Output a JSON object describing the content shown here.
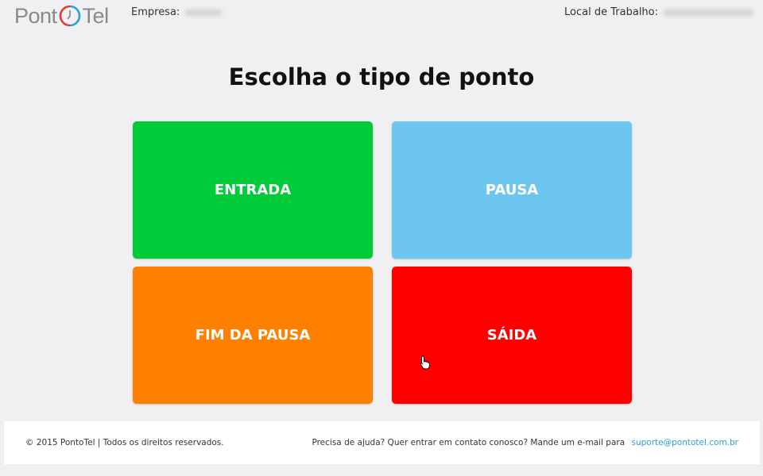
{
  "header": {
    "logo_left": "Pont",
    "logo_right": "Tel",
    "company_label": "Empresa:",
    "workplace_label": "Local de Trabalho:"
  },
  "main": {
    "title": "Escolha o tipo de ponto",
    "buttons": [
      {
        "label": "ENTRADA",
        "color": "#00cc3a"
      },
      {
        "label": "PAUSA",
        "color": "#6cc6ef"
      },
      {
        "label": "FIM DA PAUSA",
        "color": "#ff8000"
      },
      {
        "label": "SÁIDA",
        "color": "#ff0000"
      }
    ]
  },
  "footer": {
    "copyright": "© 2015 PontoTel | Todos os direitos reservados.",
    "help_text": "Precisa de ajuda? Quer entrar em contato conosco? Mande um e-mail para",
    "email": "suporte@pontotel.com.br"
  },
  "colors": {
    "logo_gray": "#8a8a8a",
    "clock_red": "#e53935",
    "clock_blue": "#2aa0d8",
    "link_blue": "#2aa0d8"
  }
}
